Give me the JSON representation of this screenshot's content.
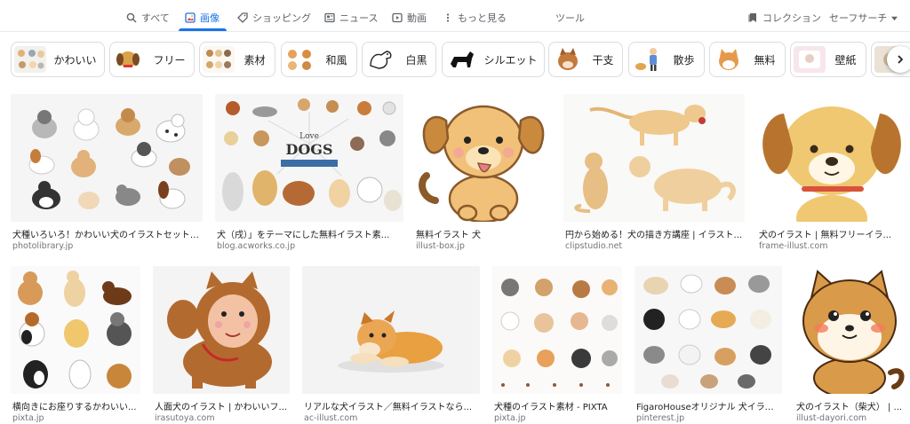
{
  "nav": {
    "items": [
      {
        "label": "すべて",
        "icon": "search-icon"
      },
      {
        "label": "画像",
        "icon": "image-icon",
        "active": true
      },
      {
        "label": "ショッピング",
        "icon": "shopping-tag-icon"
      },
      {
        "label": "ニュース",
        "icon": "news-icon"
      },
      {
        "label": "動画",
        "icon": "video-icon"
      },
      {
        "label": "もっと見る",
        "icon": "more-dots-icon"
      }
    ],
    "tools": "ツール",
    "collections": "コレクション",
    "safesearch": "セーフサーチ",
    "accent": "#1a73e8"
  },
  "chips": [
    {
      "label": "かわいい"
    },
    {
      "label": "フリー"
    },
    {
      "label": "素材"
    },
    {
      "label": "和風"
    },
    {
      "label": "白黒"
    },
    {
      "label": "シルエット"
    },
    {
      "label": "干支"
    },
    {
      "label": "散歩"
    },
    {
      "label": "無料"
    },
    {
      "label": "壁紙"
    }
  ],
  "results": [
    {
      "title": "犬種いろいろ！かわいい犬のイラストセット ...",
      "source": "photolibrary.jp"
    },
    {
      "title": "犬（戌）」をテーマにした無料イラスト素...",
      "source": "blog.acworks.co.jp",
      "image_text": "Love DOGS"
    },
    {
      "title": "無料イラスト 犬",
      "source": "illust-box.jp"
    },
    {
      "title": "円から始める！犬の描き方講座 | イラスト...",
      "source": "clipstudio.net"
    },
    {
      "title": "犬のイラスト | 無料フリーイラ...",
      "source": "frame-illust.com"
    },
    {
      "title": "横向きにお座りするかわいい...",
      "source": "pixta.jp"
    },
    {
      "title": "人面犬のイラスト | かわいいフ...",
      "source": "irasutoya.com"
    },
    {
      "title": "リアルな犬イラスト／無料イラストなら...",
      "source": "ac-illust.com"
    },
    {
      "title": "犬種のイラスト素材 - PIXTA",
      "source": "pixta.jp"
    },
    {
      "title": "FigaroHouseオリジナル 犬イラス...",
      "source": "pinterest.jp"
    },
    {
      "title": "犬のイラスト（柴犬） | ...",
      "source": "illust-dayori.com"
    }
  ]
}
